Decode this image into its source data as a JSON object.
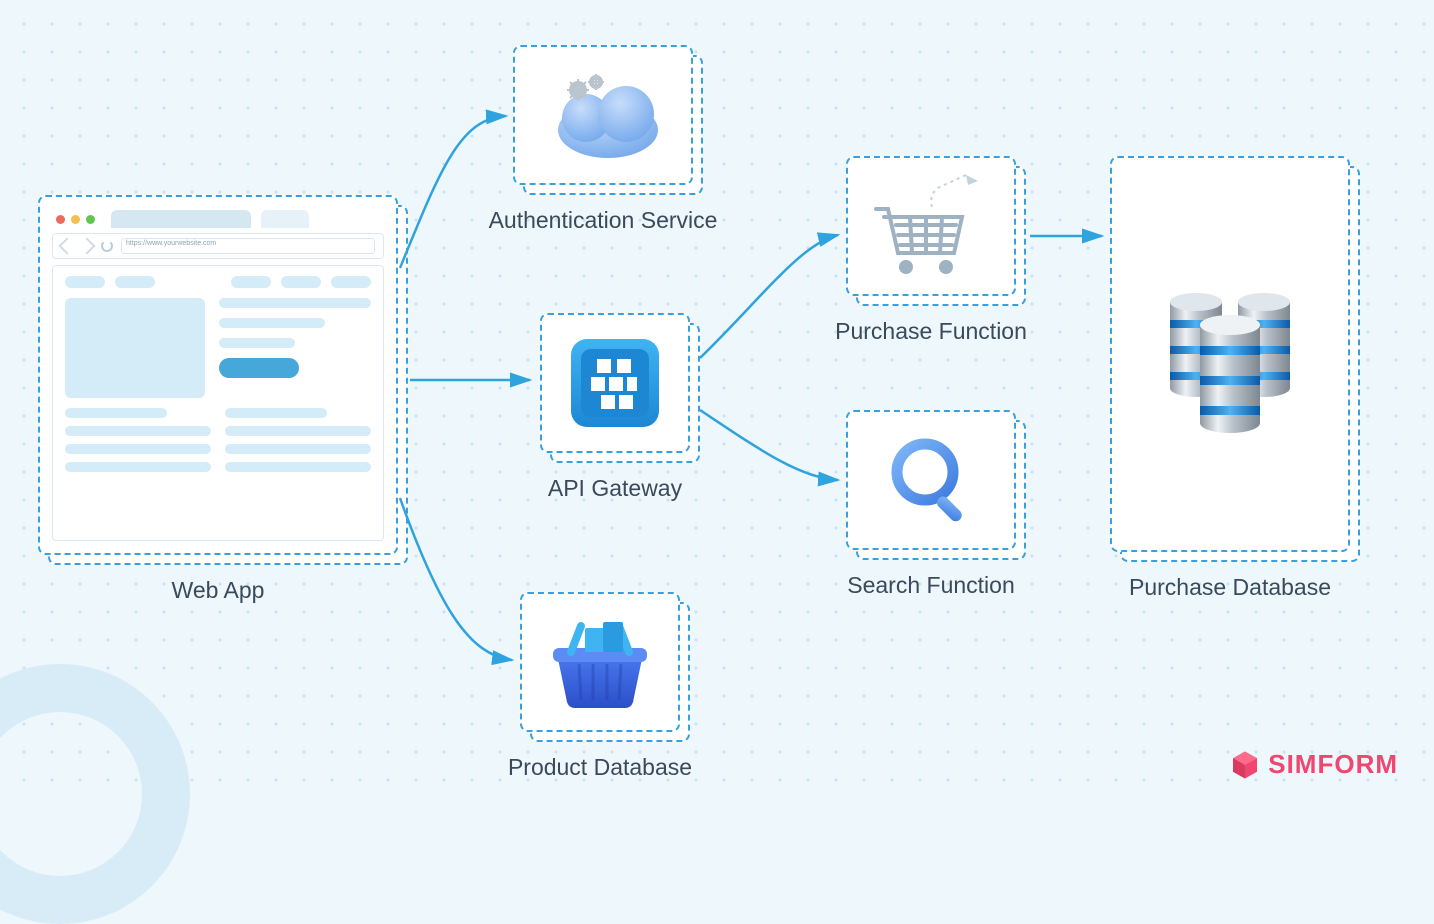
{
  "nodes": {
    "web_app": {
      "label": "Web App",
      "url_text": "https://www.yourwebsite.com",
      "icon": "browser-window"
    },
    "auth": {
      "label": "Authentication Service",
      "icon": "cloud-gears"
    },
    "api": {
      "label": "API Gateway",
      "icon": "api-block"
    },
    "product": {
      "label": "Product Database",
      "icon": "basket"
    },
    "purchase_fn": {
      "label": "Purchase Function",
      "icon": "shopping-cart"
    },
    "search_fn": {
      "label": "Search Function",
      "icon": "magnifier"
    },
    "purchase_db": {
      "label": "Purchase Database",
      "icon": "db-cluster"
    }
  },
  "edges": [
    {
      "from": "web_app",
      "to": "auth"
    },
    {
      "from": "web_app",
      "to": "api"
    },
    {
      "from": "web_app",
      "to": "product"
    },
    {
      "from": "api",
      "to": "purchase_fn"
    },
    {
      "from": "api",
      "to": "search_fn"
    },
    {
      "from": "purchase_fn",
      "to": "purchase_db"
    }
  ],
  "brand": {
    "name": "SIMFORM",
    "color": "#ef476f"
  }
}
